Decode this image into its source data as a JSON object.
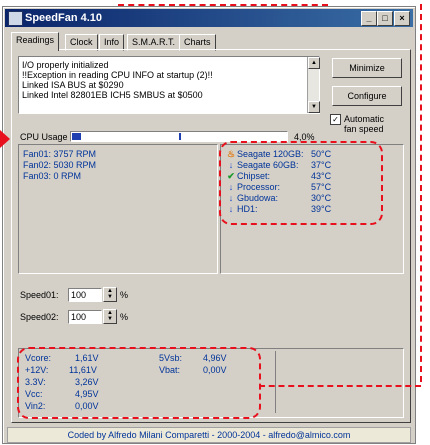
{
  "window": {
    "title": "SpeedFan 4.10"
  },
  "tabs": [
    "Readings",
    "Clock",
    "Info",
    "S.M.A.R.T.",
    "Charts"
  ],
  "log": [
    "I/O properly initialized",
    "!!Exception in reading CPU INFO at startup (2)!!",
    "Linked ISA BUS at $0290",
    "Linked Intel 82801EB ICH5 SMBUS at $0500"
  ],
  "buttons": {
    "minimize": "Minimize",
    "configure": "Configure"
  },
  "auto_fan": {
    "label1": "Automatic",
    "label2": "fan speed",
    "checked": true
  },
  "cpu_usage": {
    "label": "CPU Usage",
    "value": "4,0%",
    "fraction": 0.04
  },
  "fans": [
    "Fan01: 3757 RPM",
    "Fan02: 5030 RPM",
    "Fan03: 0 RPM"
  ],
  "temps": [
    {
      "icon": "flame-icon",
      "glyph": "♨",
      "color": "#e07a10",
      "name": "Seagate 120GB:",
      "value": "50°C"
    },
    {
      "icon": "arrow-down-icon",
      "glyph": "↓",
      "color": "#1f4fc8",
      "name": "Seagate 60GB:",
      "value": "37°C"
    },
    {
      "icon": "check-icon",
      "glyph": "✔",
      "color": "#1a9a2a",
      "name": "Chipset:",
      "value": "43°C"
    },
    {
      "icon": "arrow-down-icon",
      "glyph": "↓",
      "color": "#1f4fc8",
      "name": "Processor:",
      "value": "57°C"
    },
    {
      "icon": "arrow-down-icon",
      "glyph": "↓",
      "color": "#1f4fc8",
      "name": "Gbudowa:",
      "value": "30°C"
    },
    {
      "icon": "arrow-down-icon",
      "glyph": "↓",
      "color": "#1f4fc8",
      "name": "HD1:",
      "value": "39°C"
    }
  ],
  "speeds": [
    {
      "label": "Speed01:",
      "value": "100",
      "unit": "%"
    },
    {
      "label": "Speed02:",
      "value": "100",
      "unit": "%"
    }
  ],
  "voltages_left": [
    {
      "name": "Vcore:",
      "value": "1,61V"
    },
    {
      "name": "+12V:",
      "value": "11,61V"
    },
    {
      "name": "3.3V:",
      "value": "3,26V"
    },
    {
      "name": "Vcc:",
      "value": "4,95V"
    },
    {
      "name": "Vin2:",
      "value": "0,00V"
    }
  ],
  "voltages_right": [
    {
      "name": "5Vsb:",
      "value": "4,96V"
    },
    {
      "name": "Vbat:",
      "value": "0,00V"
    }
  ],
  "footer": "Coded by Alfredo Milani Comparetti - 2000-2004 - alfredo@almico.com",
  "colors": {
    "accent_red": "#e8101c",
    "title_bar": "#0a246a",
    "reading_text": "#003399"
  }
}
